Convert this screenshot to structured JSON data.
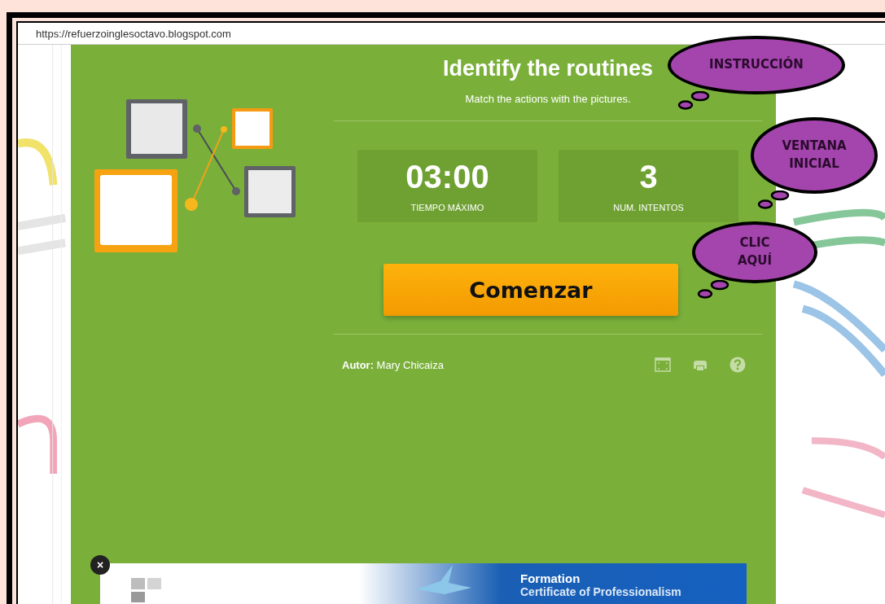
{
  "browser": {
    "url": "https://refuerzoinglesoctavo.blogspot.com"
  },
  "activity": {
    "title": "Identify the routines",
    "instruction": "Match the actions with the pictures.",
    "stats": [
      {
        "value": "03:00",
        "label": "TIEMPO MÁXIMO"
      },
      {
        "value": "3",
        "label": "NUM. INTENTOS"
      }
    ],
    "start_button": "Comenzar",
    "author_label": "Autor:",
    "author": "Mary Chicaiza",
    "tools": [
      {
        "kind": "fullscreen"
      },
      {
        "kind": "print"
      },
      {
        "kind": "help"
      }
    ]
  },
  "ad": {
    "close": "×",
    "heading": "Formation",
    "subheading": "Certificate of Professionalism"
  },
  "callouts": [
    {
      "text": "INSTRUCCIÓN"
    },
    {
      "text": "VENTANA\nINICIAL"
    },
    {
      "text": "CLIC\nAQUÍ"
    }
  ]
}
